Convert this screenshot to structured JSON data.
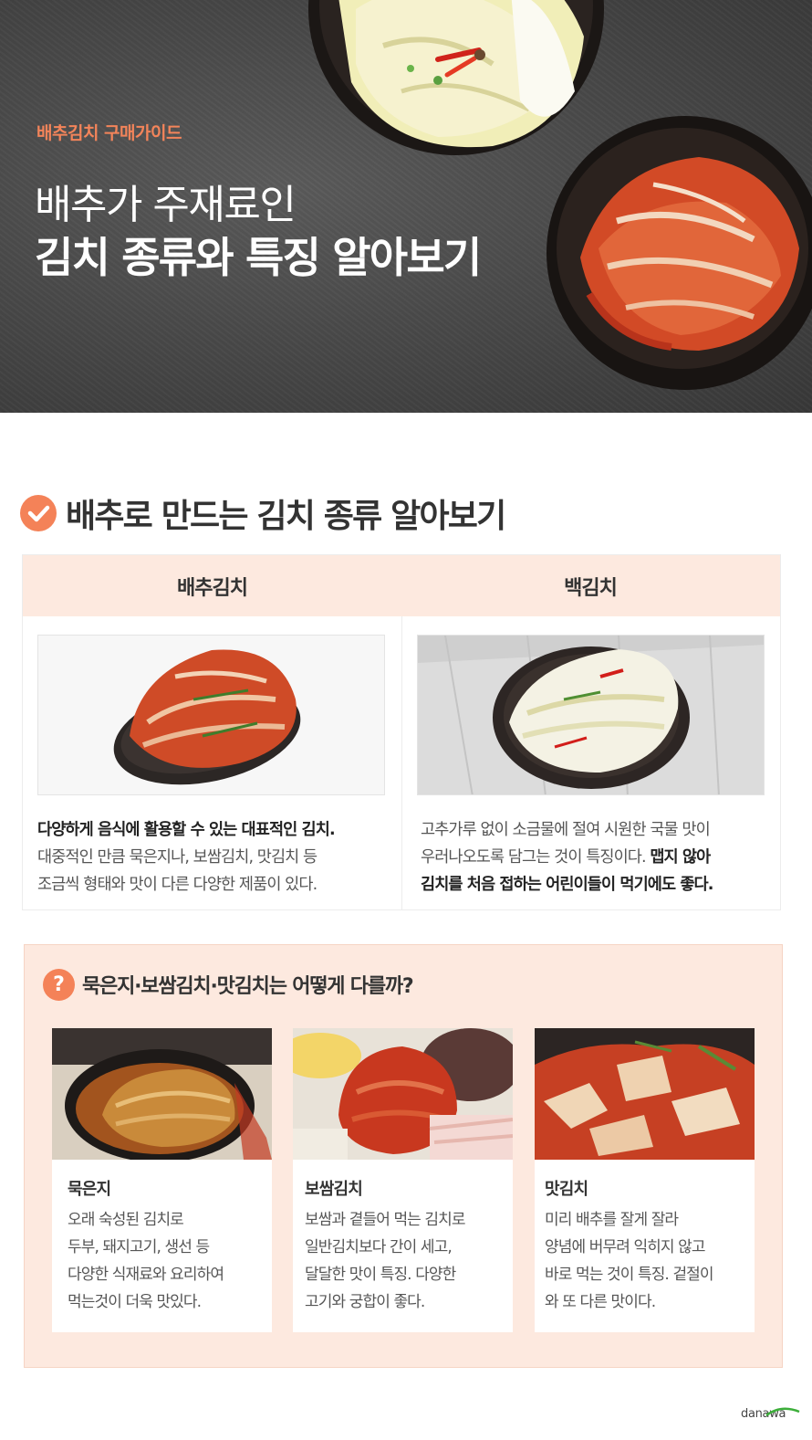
{
  "hero": {
    "eyebrow": "배추김치 구매가이드",
    "title_line1": "배추가 주재료인",
    "title_line2": "김치 종류와 특징 알아보기"
  },
  "section1": {
    "title": "배추로 만드는 김치 종류 알아보기",
    "columns": [
      {
        "name": "배추김치",
        "photo_icon": "kimchi-dish-photo",
        "desc_bold": "다양하게 음식에 활용할 수 있는 대표적인 김치.",
        "desc_line2": "대중적인 만큼 묵은지나, 보쌈김치, 맛김치 등",
        "desc_line3": "조금씩 형태와 맛이 다른 다양한 제품이 있다."
      },
      {
        "name": "백김치",
        "photo_icon": "white-kimchi-dish-photo",
        "desc_line1": "고추가루 없이 소금물에 절여 시원한 국물 맛이",
        "desc_line2_plain": "우러나오도록 담그는 것이 특징이다. ",
        "desc_line2_bold": "맵지 않아",
        "desc_line3_bold": "김치를 처음 접하는 어린이들이 먹기에도 좋다."
      }
    ]
  },
  "section2": {
    "icon": "?",
    "title": "묵은지·보쌈김치·맛김치는 어떻게 다를까?",
    "cards": [
      {
        "name": "묵은지",
        "lines": [
          "오래 숙성된 김치로",
          "두부, 돼지고기, 생선 등",
          "다양한 식재료와 요리하여",
          "먹는것이 더욱 맛있다."
        ]
      },
      {
        "name": "보쌈김치",
        "lines": [
          "보쌈과 곁들어 먹는 김치로",
          "일반김치보다 간이 세고,",
          "달달한 맛이 특징. 다양한",
          "고기와 궁합이 좋다."
        ]
      },
      {
        "name": "맛김치",
        "lines": [
          "미리 배추를 잘게 잘라",
          "양념에 버무려 익히지 않고",
          "바로 먹는 것이 특징. 겉절이",
          "와 또 다른 맛이다."
        ]
      }
    ]
  },
  "footer": {
    "brand": "danawa"
  },
  "colors": {
    "accent": "#f48258",
    "header_bg": "#fde9df",
    "hero_bg": "#4a4a4a"
  }
}
